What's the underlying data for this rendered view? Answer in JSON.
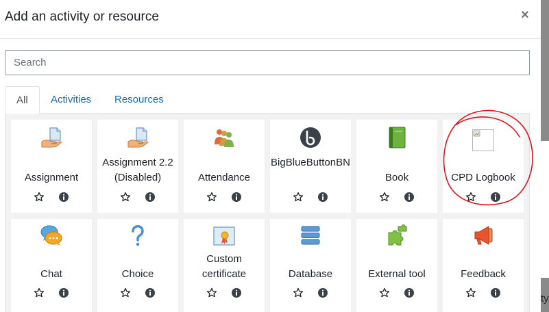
{
  "modal": {
    "title": "Add an activity or resource",
    "close_glyph": "×"
  },
  "search": {
    "placeholder": "Search",
    "value": ""
  },
  "tabs": [
    {
      "label": "All",
      "active": true
    },
    {
      "label": "Activities",
      "active": false
    },
    {
      "label": "Resources",
      "active": false
    }
  ],
  "modules": [
    {
      "label": "Assignment",
      "icon": "assignment-icon"
    },
    {
      "label": "Assignment 2.2 (Disabled)",
      "icon": "assignment-icon"
    },
    {
      "label": "Attendance",
      "icon": "attendance-icon"
    },
    {
      "label": "BigBlueButtonBN",
      "icon": "bigbluebutton-icon"
    },
    {
      "label": "Book",
      "icon": "book-icon"
    },
    {
      "label": "CPD Logbook",
      "icon": "broken-image-icon"
    },
    {
      "label": "Chat",
      "icon": "chat-icon"
    },
    {
      "label": "Choice",
      "icon": "choice-icon"
    },
    {
      "label": "Custom certificate",
      "icon": "certificate-icon"
    },
    {
      "label": "Database",
      "icon": "database-icon"
    },
    {
      "label": "External tool",
      "icon": "puzzle-icon"
    },
    {
      "label": "Feedback",
      "icon": "megaphone-icon"
    }
  ],
  "backdrop_fragment": "ty",
  "colors": {
    "link": "#0f6cbf",
    "annotation": "#e0141e",
    "icon_dark": "#3a4148",
    "star": "#1d2125"
  }
}
